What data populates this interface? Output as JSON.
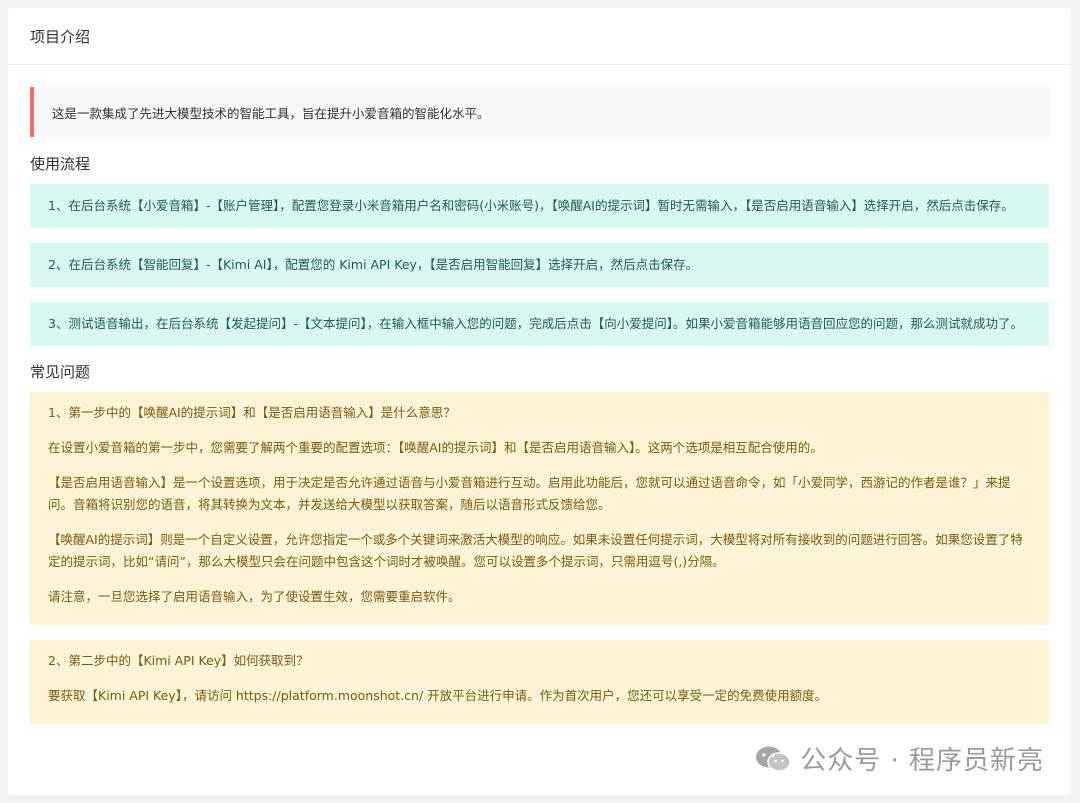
{
  "header": {
    "title": "项目介绍"
  },
  "intro": {
    "text": "这是一款集成了先进大模型技术的智能工具，旨在提升小爱音箱的智能化水平。"
  },
  "usage": {
    "title": "使用流程",
    "steps": [
      "1、在后台系统【小爱音箱】-【账户管理】，配置您登录小米音箱用户名和密码(小米账号)，【唤醒AI的提示词】暂时无需输入，【是否启用语音输入】选择开启，然后点击保存。",
      "2、在后台系统【智能回复】-【Kimi AI】，配置您的 Kimi API Key，【是否启用智能回复】选择开启，然后点击保存。",
      "3、测试语音输出，在后台系统【发起提问】-【文本提问】，在输入框中输入您的问题，完成后点击【向小爱提问】。如果小爱音箱能够用语音回应您的问题，那么测试就成功了。"
    ]
  },
  "faq": {
    "title": "常见问题",
    "items": [
      {
        "question": "1、第一步中的【唤醒AI的提示词】和【是否启用语音输入】是什么意思？",
        "paragraphs": [
          "在设置小爱音箱的第一步中，您需要了解两个重要的配置选项：【唤醒AI的提示词】和【是否启用语音输入】。这两个选项是相互配合使用的。",
          "【是否启用语音输入】是一个设置选项，用于决定是否允许通过语音与小爱音箱进行互动。启用此功能后，您就可以通过语音命令，如「小爱同学，西游记的作者是谁？」来提问。音箱将识别您的语音，将其转换为文本，并发送给大模型以获取答案，随后以语音形式反馈给您。",
          "【唤醒AI的提示词】则是一个自定义设置，允许您指定一个或多个关键词来激活大模型的响应。如果未设置任何提示词，大模型将对所有接收到的问题进行回答。如果您设置了特定的提示词，比如“请问”，那么大模型只会在问题中包含这个词时才被唤醒。您可以设置多个提示词，只需用逗号(,)分隔。",
          "请注意，一旦您选择了启用语音输入，为了使设置生效，您需要重启软件。"
        ]
      },
      {
        "question": "2、第二步中的【Kimi API Key】如何获取到？",
        "paragraphs": [
          "要获取【Kimi API Key】，请访问 https://platform.moonshot.cn/ 开放平台进行申请。作为首次用户，您还可以享受一定的免费使用额度。"
        ]
      }
    ]
  },
  "watermark": {
    "icon": "wechat-icon",
    "text": "公众号 · 程序员新亮"
  },
  "colors": {
    "step_bg": "#d9f7f3",
    "step_text": "#1f5c55",
    "faq_bg": "#fdf3d6",
    "faq_text": "#7a5a10",
    "intro_border": "#f56c6c"
  }
}
